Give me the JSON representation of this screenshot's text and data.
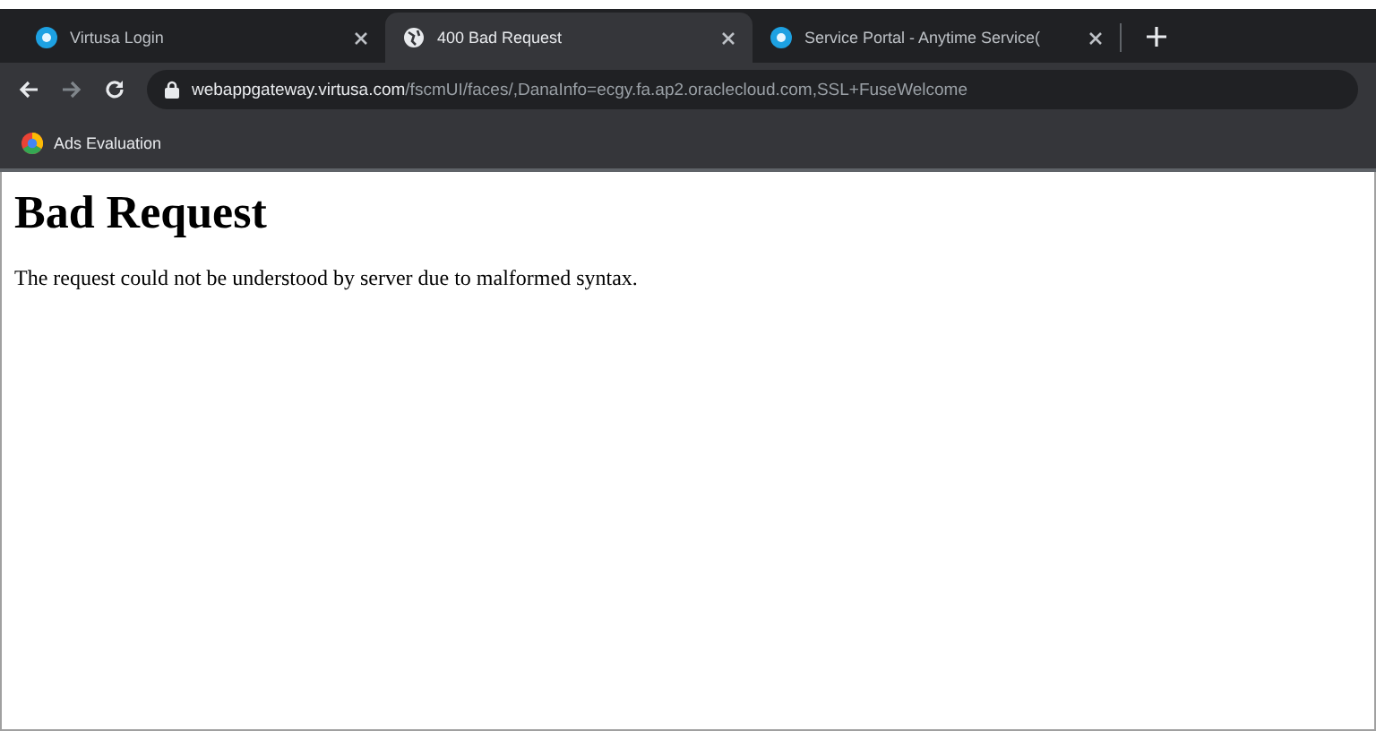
{
  "tabs": [
    {
      "title": "Virtusa Login",
      "kind": "site",
      "selected": false
    },
    {
      "title": "400 Bad Request",
      "kind": "error",
      "selected": true
    },
    {
      "title": "Service Portal - Anytime Service(",
      "kind": "site",
      "selected": false
    }
  ],
  "address": {
    "domain": "webappgateway.virtusa.com",
    "path": "/fscmUI/faces/,DanaInfo=ecgy.fa.ap2.oraclecloud.com,SSL+FuseWelcome"
  },
  "bookmarks": [
    {
      "label": "Ads Evaluation"
    }
  ],
  "page": {
    "heading": "Bad Request",
    "message": "The request could not be understood by server due to malformed syntax."
  }
}
